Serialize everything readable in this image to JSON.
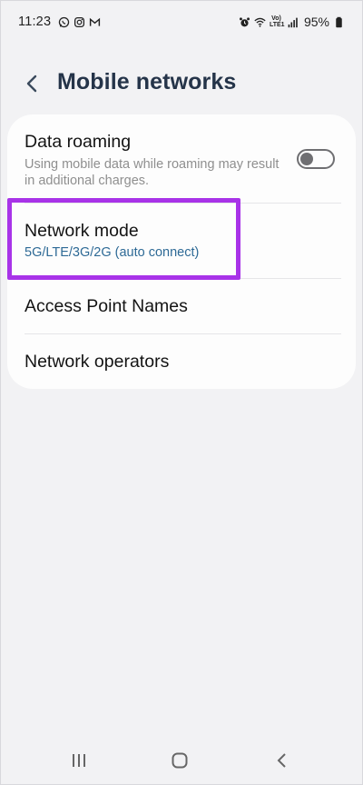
{
  "status_bar": {
    "time": "11:23",
    "battery_percent": "95%",
    "network_label": "VoLTE1\nLTE1",
    "left_icons": [
      "whatsapp-icon",
      "instagram-icon",
      "gmail-icon"
    ],
    "right_icons": [
      "alarm-icon",
      "wifi-icon",
      "lte-icon",
      "signal-icon",
      "battery-icon"
    ]
  },
  "header": {
    "title": "Mobile networks",
    "back_icon": "chevron-left-icon"
  },
  "settings": {
    "data_roaming": {
      "title": "Data roaming",
      "subtitle": "Using mobile data while roaming may result in additional charges.",
      "toggle_on": false
    },
    "network_mode": {
      "title": "Network mode",
      "value": "5G/LTE/3G/2G (auto connect)",
      "highlighted": true
    },
    "access_point_names": {
      "title": "Access Point Names"
    },
    "network_operators": {
      "title": "Network operators"
    }
  },
  "colors": {
    "background": "#f2f2f4",
    "card": "#fdfdfd",
    "title_text": "#253449",
    "accent_value": "#2e6a96",
    "subtitle_text": "#8f8f8f",
    "highlight_border": "#a833e8"
  },
  "nav_bar": {
    "buttons": [
      "recents-icon",
      "home-icon",
      "back-nav-icon"
    ]
  }
}
